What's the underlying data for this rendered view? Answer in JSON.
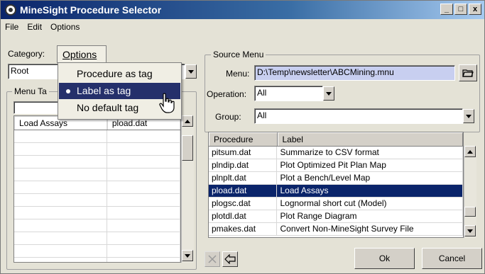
{
  "window": {
    "title": "MineSight Procedure Selector",
    "controls": [
      "_",
      "□",
      "x"
    ]
  },
  "menubar": {
    "items": [
      "File",
      "Edit",
      "Options"
    ]
  },
  "left": {
    "category_label": "Category:",
    "category_value": "Root",
    "menu_tab_group": "Menu Ta",
    "tab_partial": "T",
    "table": {
      "headers": [
        "Load Assays",
        "pload.dat"
      ],
      "rows": 12
    }
  },
  "options_popup": {
    "tab_label": "Options",
    "items": [
      {
        "label": "Procedure as tag",
        "selected": false
      },
      {
        "label": "Label as tag",
        "selected": true
      },
      {
        "label": "No default tag",
        "selected": false
      }
    ]
  },
  "source_menu": {
    "group_title": "Source Menu",
    "menu_label": "Menu:",
    "menu_value": "D:\\Temp\\newsletter\\ABCMining.mnu",
    "operation_label": "Operation:",
    "operation_value": "All",
    "group_label": "Group:",
    "group_value": "All"
  },
  "procedures": {
    "headers": [
      "Procedure",
      "Label"
    ],
    "rows": [
      {
        "procedure": "pitsum.dat",
        "label": "Summarize to CSV format",
        "selected": false
      },
      {
        "procedure": "plndip.dat",
        "label": "Plot Optimized Pit Plan Map",
        "selected": false
      },
      {
        "procedure": "plnplt.dat",
        "label": "Plot a Bench/Level Map",
        "selected": false
      },
      {
        "procedure": "pload.dat",
        "label": "Load Assays",
        "selected": true
      },
      {
        "procedure": "plogsc.dat",
        "label": "Lognormal short cut (Model)",
        "selected": false
      },
      {
        "procedure": "plotdl.dat",
        "label": "Plot Range Diagram",
        "selected": false
      },
      {
        "procedure": "pmakes.dat",
        "label": "Convert Non-MineSight Survey File",
        "selected": false
      }
    ]
  },
  "buttons": {
    "ok": "Ok",
    "cancel": "Cancel"
  },
  "colors": {
    "selection": "#0a246a",
    "popup_active": "#25306b"
  }
}
